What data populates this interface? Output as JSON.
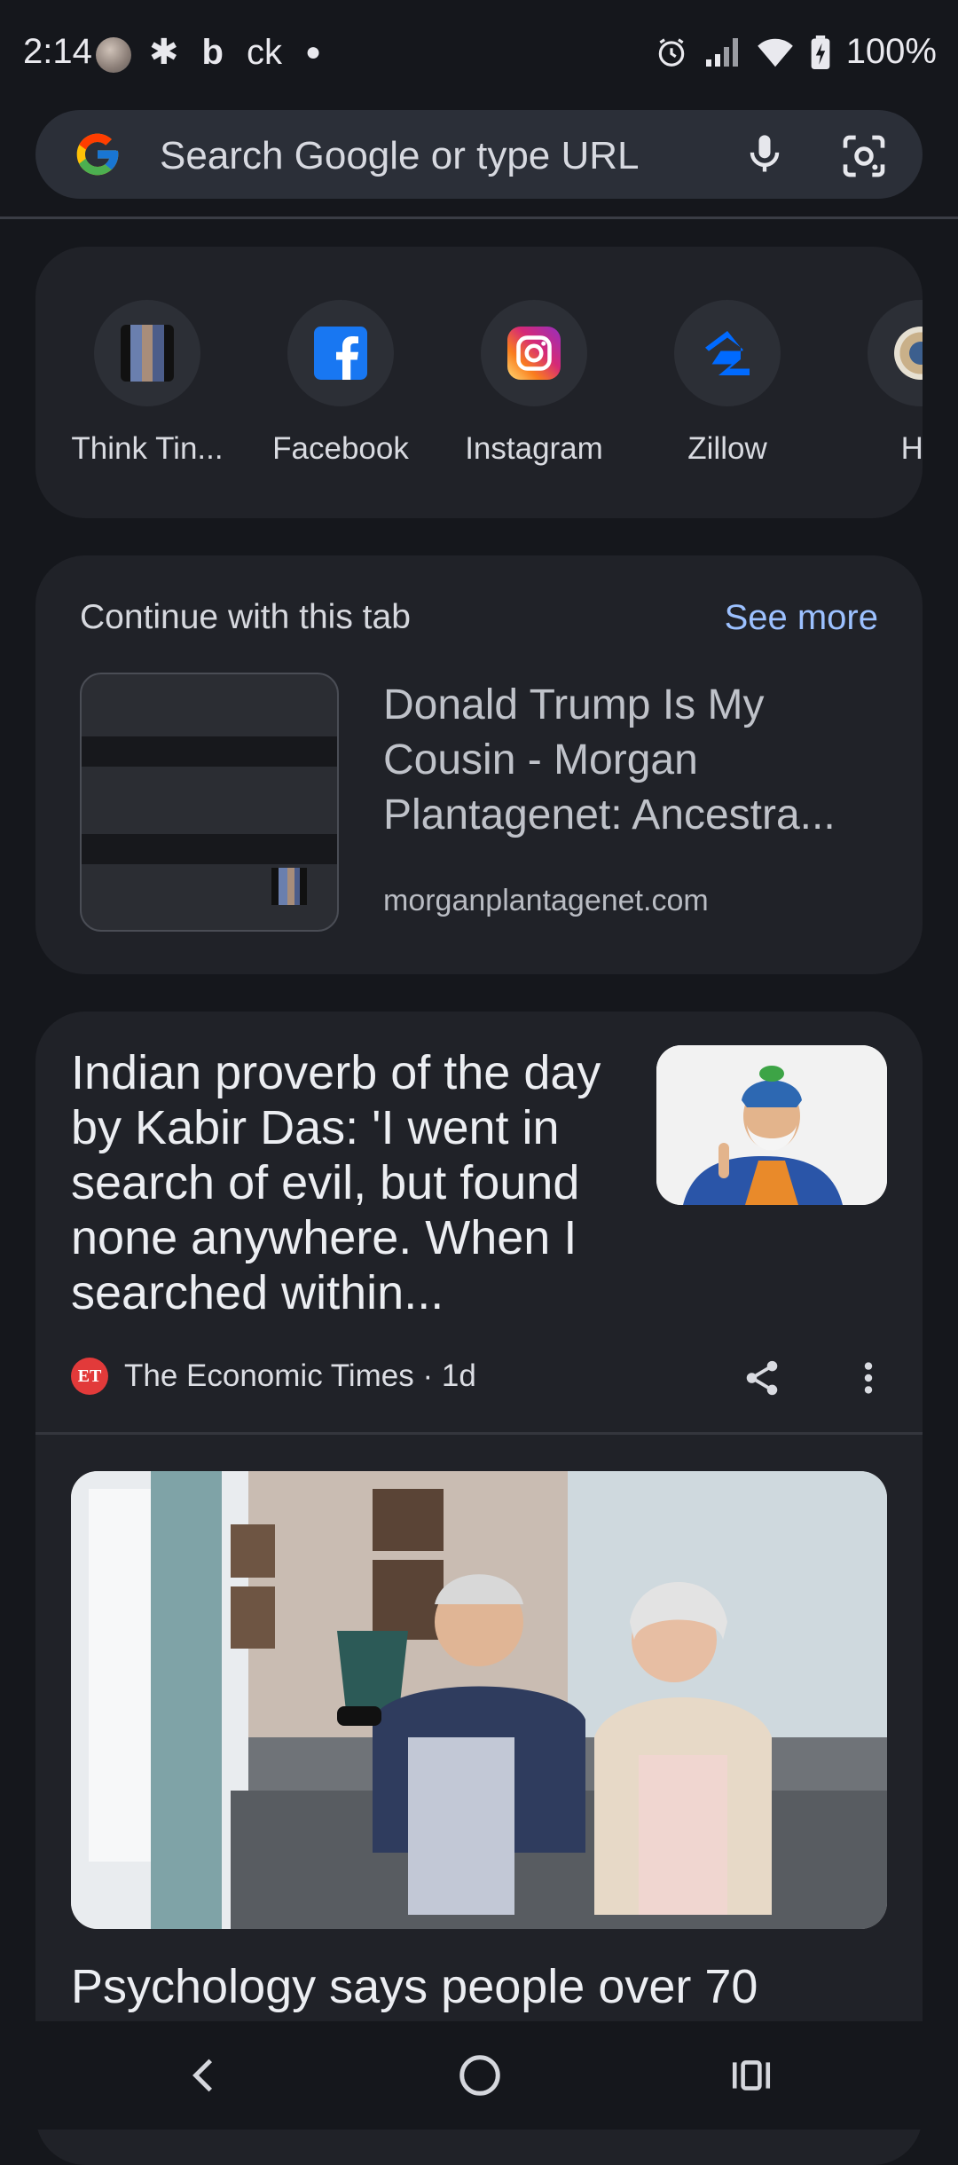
{
  "status_bar": {
    "time": "2:14",
    "carrier_text": "ck",
    "battery": "100%"
  },
  "search": {
    "placeholder": "Search Google or type URL"
  },
  "shortcuts": [
    {
      "label": "Think Tin...",
      "icon": "think-tank-thumbnail"
    },
    {
      "label": "Facebook",
      "icon": "facebook-icon"
    },
    {
      "label": "Instagram",
      "icon": "instagram-icon"
    },
    {
      "label": "Zillow",
      "icon": "zillow-icon"
    },
    {
      "label": "Ho",
      "icon": "partial-site-icon"
    }
  ],
  "continue_tab": {
    "title": "Continue with this tab",
    "see_more": "See more",
    "headline": "Donald Trump Is My Cousin - Morgan Plantagenet: Ancestra...",
    "domain": "morganplantagenet.com"
  },
  "feed": {
    "card1": {
      "headline": "Indian proverb of the day by Kabir Das: 'I went in search of evil, but found none anywhere. When I searched within...",
      "source_badge": "ET",
      "source": "The Economic Times · 1d"
    },
    "card2": {
      "headline": "Psychology says people over 70"
    }
  },
  "colors": {
    "background": "#15171c",
    "card": "#202228",
    "accent_link": "#9cc1ff"
  }
}
